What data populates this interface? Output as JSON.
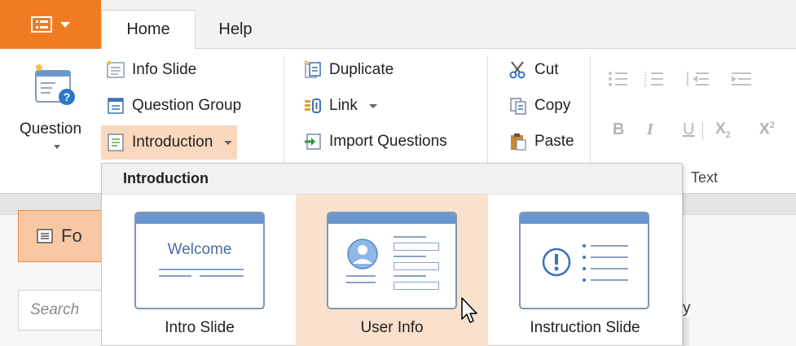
{
  "tabs": [
    {
      "label": "Home",
      "active": true
    },
    {
      "label": "Help",
      "active": false
    }
  ],
  "ribbon": {
    "question": {
      "label": "Question"
    },
    "insert_items": [
      {
        "label": "Info Slide",
        "icon": "info-slide-icon"
      },
      {
        "label": "Question Group",
        "icon": "question-group-icon"
      },
      {
        "label": "Introduction",
        "icon": "introduction-icon",
        "dropdown": true,
        "open": true
      }
    ],
    "edit_items": [
      {
        "label": "Duplicate",
        "icon": "duplicate-icon"
      },
      {
        "label": "Link",
        "icon": "link-icon",
        "dropdown": true
      },
      {
        "label": "Import Questions",
        "icon": "import-questions-icon"
      }
    ],
    "clipboard": [
      {
        "label": "Cut",
        "icon": "scissors-icon"
      },
      {
        "label": "Copy",
        "icon": "copy-icon"
      },
      {
        "label": "Paste",
        "icon": "paste-icon"
      }
    ],
    "text_group_label": "Text",
    "format_buttons": {
      "bold": "B",
      "italic": "I",
      "underline": "U",
      "subscript": "X",
      "subscript_mark": "2",
      "superscript": "X",
      "superscript_mark": "2"
    }
  },
  "left_panel": {
    "button_label_partial": "Fo",
    "search_placeholder": "Search"
  },
  "right_panel_partial": "y",
  "dropdown": {
    "title": "Introduction",
    "items": [
      {
        "label": "Intro Slide",
        "card_text": "Welcome",
        "hovered": false
      },
      {
        "label": "User Info",
        "hovered": true
      },
      {
        "label": "Instruction Slide",
        "hovered": false
      }
    ]
  },
  "colors": {
    "accent": "#f07b22",
    "hover_bg": "#f9e1cd",
    "card_bar": "#6b97d0",
    "card_border": "#7f97b4"
  }
}
